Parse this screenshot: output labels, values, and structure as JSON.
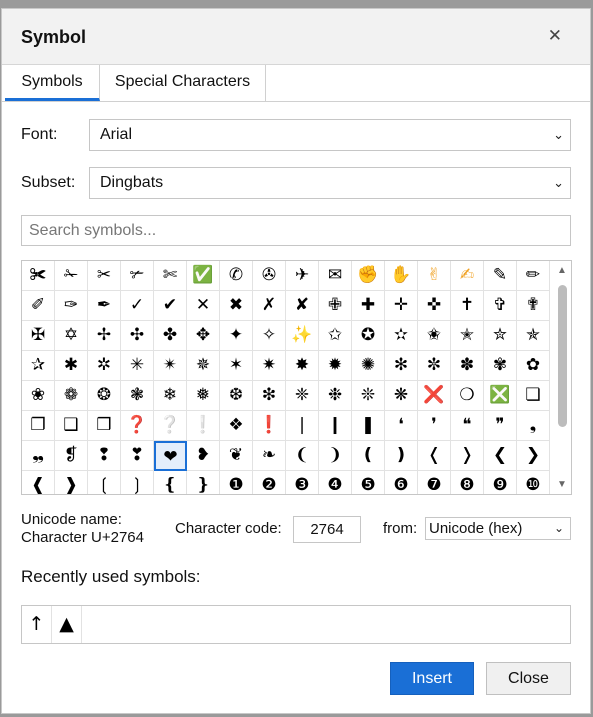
{
  "dialog": {
    "title": "Symbol",
    "close_glyph": "✕",
    "tabs": [
      "Symbols",
      "Special Characters"
    ],
    "font_label": "Font:",
    "font_value": "Arial",
    "subset_label": "Subset:",
    "subset_value": "Dingbats",
    "search_placeholder": "Search symbols...",
    "unicode_name_label": "Unicode name:",
    "unicode_name_value": "Character U+2764",
    "code_label": "Character code:",
    "code_value": "2764",
    "from_label": "from:",
    "from_value": "Unicode (hex)",
    "recent_label": "Recently used symbols:",
    "recent": [
      "↑",
      "▲"
    ],
    "insert_label": "Insert",
    "close_label": "Close",
    "chevron": "⌄",
    "scroll_up": "▲",
    "scroll_down": "▼"
  },
  "symbols": [
    [
      "✀",
      "✁",
      "✂",
      "✃",
      "✄",
      "✅",
      "✆",
      "✇",
      "✈",
      "✉",
      "✊",
      "✋",
      "✌",
      "✍",
      "✎",
      "✏"
    ],
    [
      "✐",
      "✑",
      "✒",
      "✓",
      "✔",
      "✕",
      "✖",
      "✗",
      "✘",
      "✙",
      "✚",
      "✛",
      "✜",
      "✝",
      "✞",
      "✟"
    ],
    [
      "✠",
      "✡",
      "✢",
      "✣",
      "✤",
      "✥",
      "✦",
      "✧",
      "✨",
      "✩",
      "✪",
      "✫",
      "✬",
      "✭",
      "✮",
      "✯"
    ],
    [
      "✰",
      "✱",
      "✲",
      "✳",
      "✴",
      "✵",
      "✶",
      "✷",
      "✸",
      "✹",
      "✺",
      "✻",
      "✼",
      "✽",
      "✾",
      "✿"
    ],
    [
      "❀",
      "❁",
      "❂",
      "❃",
      "❄",
      "❅",
      "❆",
      "❇",
      "❈",
      "❉",
      "❊",
      "❋",
      "❌",
      "❍",
      "❎",
      "❏"
    ],
    [
      "❐",
      "❑",
      "❒",
      "❓",
      "❔",
      "❕",
      "❖",
      "❗",
      "❘",
      "❙",
      "❚",
      "❛",
      "❜",
      "❝",
      "❞",
      "❟"
    ],
    [
      "❠",
      "❡",
      "❢",
      "❣",
      "❤",
      "❥",
      "❦",
      "❧",
      "❨",
      "❩",
      "❪",
      "❫",
      "❬",
      "❭",
      "❮",
      "❯"
    ],
    [
      "❰",
      "❱",
      "❲",
      "❳",
      "❴",
      "❵",
      "❶",
      "❷",
      "❸",
      "❹",
      "❺",
      "❻",
      "❼",
      "❽",
      "❾",
      "❿"
    ]
  ],
  "selected_symbol": "❤",
  "colored_symbols": {
    "✅": "#1fbf6a",
    "✊": "#f0a020",
    "✋": "#f0a020",
    "✌": "#f0a020",
    "✍": "#f0a020",
    "✨": "#f0c020",
    "❌": "#e0304a",
    "❎": "#1fbf6a",
    "❓": "#e0304a",
    "❔": "#999999",
    "❕": "#999999",
    "❗": "#e0304a"
  },
  "colors": {
    "accent": "#1a6fd6"
  }
}
